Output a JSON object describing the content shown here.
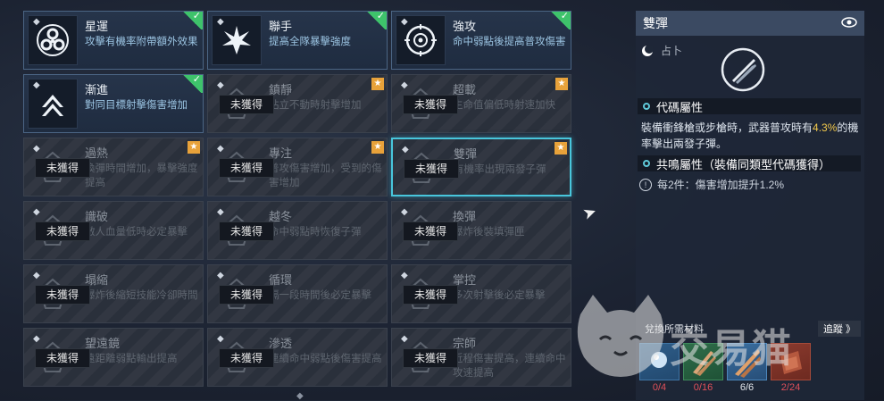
{
  "locked_label": "未獲得",
  "cards": [
    {
      "title": "星運",
      "desc": "攻擊有機率附帶額外效果",
      "state": "owned",
      "badge": "check",
      "icon": "biohazard-icon"
    },
    {
      "title": "聯手",
      "desc": "提高全隊暴擊強度",
      "state": "owned",
      "badge": "check",
      "icon": "burst-icon"
    },
    {
      "title": "強攻",
      "desc": "命中弱點後提高普攻傷害",
      "state": "owned",
      "badge": "check",
      "icon": "crosshair-icon"
    },
    {
      "title": "漸進",
      "desc": "對同目標射擊傷害增加",
      "state": "owned",
      "badge": "check",
      "icon": "chevron-up-icon"
    },
    {
      "title": "鎮靜",
      "desc": "站立不動時射擊增加",
      "state": "locked",
      "badge": "star",
      "icon": "emblem-icon"
    },
    {
      "title": "超載",
      "desc": "生命值偏低時射速加快",
      "state": "locked",
      "badge": "star",
      "icon": "emblem-icon"
    },
    {
      "title": "過熱",
      "desc": "換彈時間增加，暴擊強度提高",
      "state": "locked",
      "badge": "star",
      "icon": "emblem-icon"
    },
    {
      "title": "專注",
      "desc": "普攻傷害增加，受到的傷害增加",
      "state": "locked",
      "badge": "star",
      "icon": "emblem-icon"
    },
    {
      "title": "雙彈",
      "desc": "有機率出現兩發子彈",
      "state": "locked",
      "badge": "star",
      "icon": "emblem-icon",
      "selected": true
    },
    {
      "title": "識破",
      "desc": "敵人血量低時必定暴擊",
      "state": "locked",
      "badge": "none",
      "icon": "emblem-icon"
    },
    {
      "title": "越冬",
      "desc": "命中弱點時恢復子彈",
      "state": "locked",
      "badge": "none",
      "icon": "emblem-icon"
    },
    {
      "title": "換彈",
      "desc": "爆炸後裝填彈匣",
      "state": "locked",
      "badge": "none",
      "icon": "emblem-icon"
    },
    {
      "title": "塌縮",
      "desc": "爆炸後縮短技能冷卻時間",
      "state": "locked",
      "badge": "none",
      "icon": "emblem-icon"
    },
    {
      "title": "循環",
      "desc": "隔一段時間後必定暴擊",
      "state": "locked",
      "badge": "none",
      "icon": "emblem-icon"
    },
    {
      "title": "掌控",
      "desc": "多次射擊後必定暴擊",
      "state": "locked",
      "badge": "none",
      "icon": "emblem-icon"
    },
    {
      "title": "望遠鏡",
      "desc": "遠距離弱點輸出提高",
      "state": "locked",
      "badge": "none",
      "icon": "emblem-icon"
    },
    {
      "title": "滲透",
      "desc": "連續命中弱點後傷害提高",
      "state": "locked",
      "badge": "none",
      "icon": "emblem-icon"
    },
    {
      "title": "宗師",
      "desc": "近程傷害提高，連續命中攻速提高",
      "state": "locked",
      "badge": "none",
      "icon": "emblem-icon"
    }
  ],
  "panel": {
    "title": "雙彈",
    "type": "占卜",
    "section1": "代碼屬性",
    "body_pre": "裝備衝鋒槍或步槍時，武器普攻時有",
    "body_hl": "4.3%",
    "body_post": "的機率擊出兩發子彈。",
    "section2": "共鳴屬性（裝備同類型代碼獲得）",
    "bonus": "每2件：傷害增加提升1.2%"
  },
  "materials": {
    "label": "兌換所需材料",
    "track": "追蹤 》",
    "items": [
      {
        "count": "0/4",
        "color": "#e0505a"
      },
      {
        "count": "0/16",
        "color": "#e0505a"
      },
      {
        "count": "6/6",
        "color": "#e6e9ee"
      },
      {
        "count": "2/24",
        "color": "#e0505a"
      }
    ]
  },
  "watermark": "交易猫"
}
